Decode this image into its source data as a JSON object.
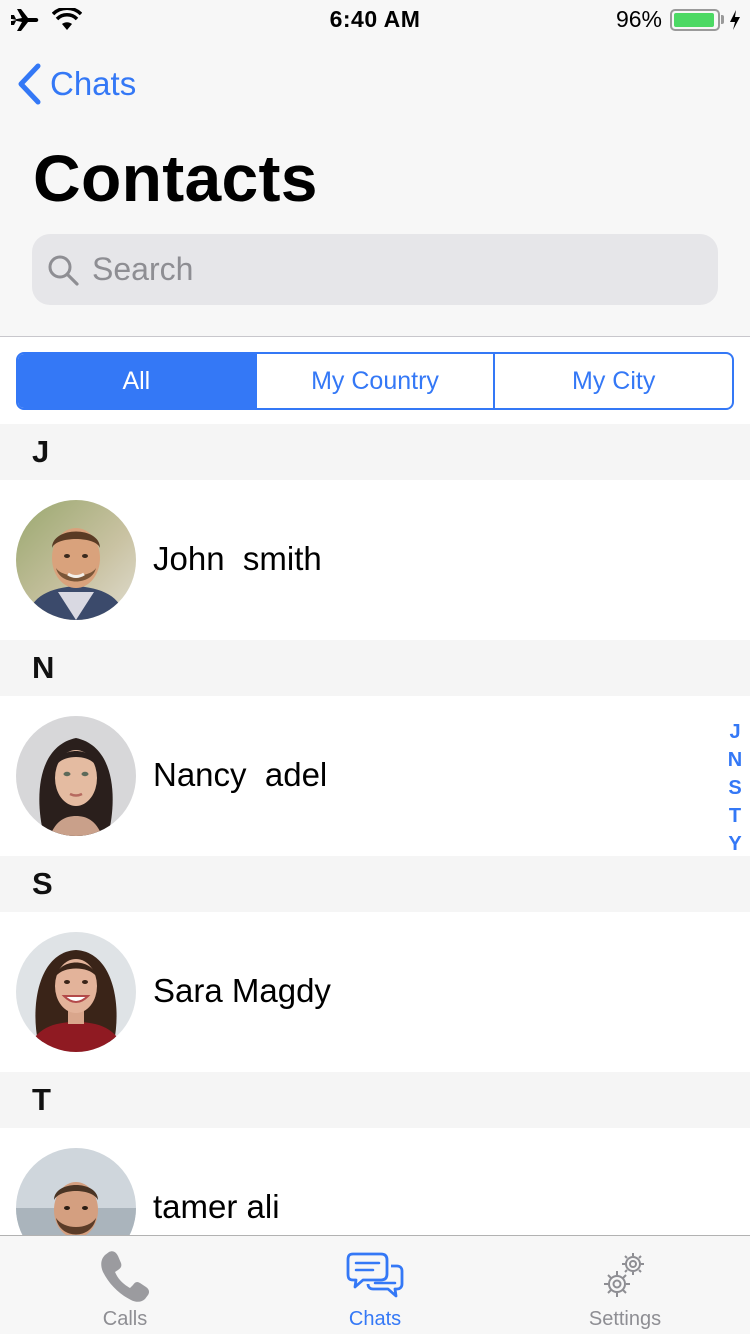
{
  "status_bar": {
    "time": "6:40 AM",
    "battery_percent": "96%",
    "battery_level": 0.96,
    "icons": [
      "airplane-icon",
      "wifi-icon",
      "battery-icon",
      "charging-bolt-icon"
    ]
  },
  "nav": {
    "back_label": "Chats",
    "title": "Contacts"
  },
  "search": {
    "placeholder": "Search",
    "value": ""
  },
  "segments": [
    {
      "label": "All",
      "selected": true
    },
    {
      "label": "My Country",
      "selected": false
    },
    {
      "label": "My City",
      "selected": false
    }
  ],
  "sections": [
    {
      "letter": "J",
      "contacts": [
        {
          "name": "John  smith",
          "avatar": "avatar-john"
        }
      ]
    },
    {
      "letter": "N",
      "contacts": [
        {
          "name": "Nancy  adel",
          "avatar": "avatar-nancy"
        }
      ]
    },
    {
      "letter": "S",
      "contacts": [
        {
          "name": "Sara Magdy",
          "avatar": "avatar-sara"
        }
      ]
    },
    {
      "letter": "T",
      "contacts": [
        {
          "name": "tamer ali",
          "avatar": "avatar-tamer"
        }
      ]
    }
  ],
  "index_letters": [
    "J",
    "N",
    "S",
    "T",
    "Y"
  ],
  "tab_bar": {
    "tabs": [
      {
        "label": "Calls",
        "icon": "phone-icon",
        "active": false
      },
      {
        "label": "Chats",
        "icon": "chat-bubbles-icon",
        "active": true
      },
      {
        "label": "Settings",
        "icon": "gears-icon",
        "active": false
      }
    ]
  },
  "colors": {
    "accent": "#3478f6",
    "battery_green": "#4cd964",
    "section_bg": "#f5f5f5",
    "inactive_tab": "#8e8e93"
  }
}
